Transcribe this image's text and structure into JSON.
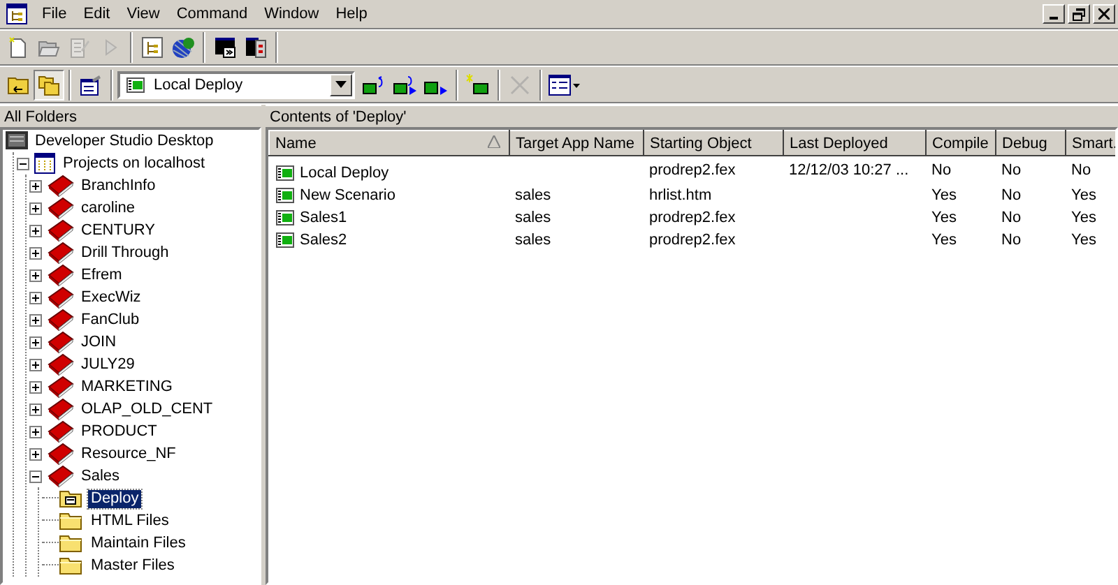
{
  "menubar": {
    "items": [
      "File",
      "Edit",
      "View",
      "Command",
      "Window",
      "Help"
    ]
  },
  "toolbar_1": [
    {
      "kind": "new",
      "disabled": false
    },
    {
      "kind": "open",
      "disabled": false
    },
    {
      "kind": "edit",
      "disabled": true
    },
    {
      "kind": "run",
      "disabled": true
    },
    {
      "kind": "sep"
    },
    {
      "kind": "tree",
      "disabled": false
    },
    {
      "kind": "globe",
      "disabled": false
    },
    {
      "kind": "sep"
    },
    {
      "kind": "console",
      "disabled": false
    },
    {
      "kind": "server",
      "disabled": false
    }
  ],
  "toolbar_2": {
    "left": [
      {
        "kind": "up",
        "pressed": false,
        "disabled": false
      },
      {
        "kind": "folders",
        "pressed": true,
        "disabled": false
      },
      {
        "kind": "sep"
      },
      {
        "kind": "props",
        "pressed": false,
        "disabled": false
      },
      {
        "kind": "sep"
      }
    ],
    "combo": {
      "value": "Local Deploy"
    },
    "right": [
      {
        "kind": "deploy1",
        "pressed": false,
        "disabled": false
      },
      {
        "kind": "deploy2",
        "pressed": false,
        "disabled": false
      },
      {
        "kind": "deploy3",
        "pressed": false,
        "disabled": false
      },
      {
        "kind": "sep"
      },
      {
        "kind": "newdeploy",
        "pressed": false,
        "disabled": false
      },
      {
        "kind": "sep"
      },
      {
        "kind": "delete",
        "pressed": false,
        "disabled": true
      },
      {
        "kind": "sep"
      },
      {
        "kind": "views",
        "pressed": false,
        "disabled": false
      }
    ]
  },
  "folders_pane": {
    "title": "All Folders"
  },
  "contents_pane": {
    "title": "Contents of 'Deploy'"
  },
  "tree": [
    {
      "label": "Developer Studio Desktop",
      "kind": "desktop",
      "selected": false,
      "children": [
        {
          "label": "Projects on localhost",
          "kind": "server",
          "selected": false,
          "expanded": true,
          "children": [
            {
              "label": "BranchInfo",
              "kind": "project",
              "selected": false,
              "expanded": false
            },
            {
              "label": "caroline",
              "kind": "project",
              "selected": false,
              "expanded": false
            },
            {
              "label": "CENTURY",
              "kind": "project",
              "selected": false,
              "expanded": false
            },
            {
              "label": "Drill Through",
              "kind": "project",
              "selected": false,
              "expanded": false
            },
            {
              "label": "Efrem",
              "kind": "project",
              "selected": false,
              "expanded": false
            },
            {
              "label": "ExecWiz",
              "kind": "project",
              "selected": false,
              "expanded": false
            },
            {
              "label": "FanClub",
              "kind": "project",
              "selected": false,
              "expanded": false
            },
            {
              "label": "JOIN",
              "kind": "project",
              "selected": false,
              "expanded": false
            },
            {
              "label": "JULY29",
              "kind": "project",
              "selected": false,
              "expanded": false
            },
            {
              "label": "MARKETING",
              "kind": "project",
              "selected": false,
              "expanded": false
            },
            {
              "label": "OLAP_OLD_CENT",
              "kind": "project",
              "selected": false,
              "expanded": false
            },
            {
              "label": "PRODUCT",
              "kind": "project",
              "selected": false,
              "expanded": false
            },
            {
              "label": "Resource_NF",
              "kind": "project",
              "selected": false,
              "expanded": false
            },
            {
              "label": "Sales",
              "kind": "project",
              "selected": false,
              "expanded": true,
              "children": [
                {
                  "label": "Deploy",
                  "kind": "deploy",
                  "selected": true
                },
                {
                  "label": "HTML Files",
                  "kind": "folder",
                  "selected": false
                },
                {
                  "label": "Maintain Files",
                  "kind": "folder",
                  "selected": false
                },
                {
                  "label": "Master Files",
                  "kind": "folder",
                  "selected": false
                }
              ]
            }
          ]
        }
      ]
    }
  ],
  "table": {
    "columns": [
      {
        "label": "Name",
        "sorted": true
      },
      {
        "label": "Target App Name",
        "sorted": false
      },
      {
        "label": "Starting Object",
        "sorted": false
      },
      {
        "label": "Last Deployed",
        "sorted": false
      },
      {
        "label": "Compile",
        "sorted": false
      },
      {
        "label": "Debug",
        "sorted": false
      },
      {
        "label": "Smart.",
        "sorted": false
      }
    ],
    "rows": [
      {
        "cells": [
          "Local Deploy",
          "",
          "prodrep2.fex",
          "12/12/03 10:27 ...",
          "No",
          "No",
          "No"
        ]
      },
      {
        "cells": [
          "New Scenario",
          "sales",
          "hrlist.htm",
          "",
          "Yes",
          "No",
          "Yes"
        ]
      },
      {
        "cells": [
          "Sales1",
          "sales",
          "prodrep2.fex",
          "",
          "Yes",
          "No",
          "Yes"
        ]
      },
      {
        "cells": [
          "Sales2",
          "sales",
          "prodrep2.fex",
          "",
          "Yes",
          "No",
          "Yes"
        ]
      }
    ]
  }
}
